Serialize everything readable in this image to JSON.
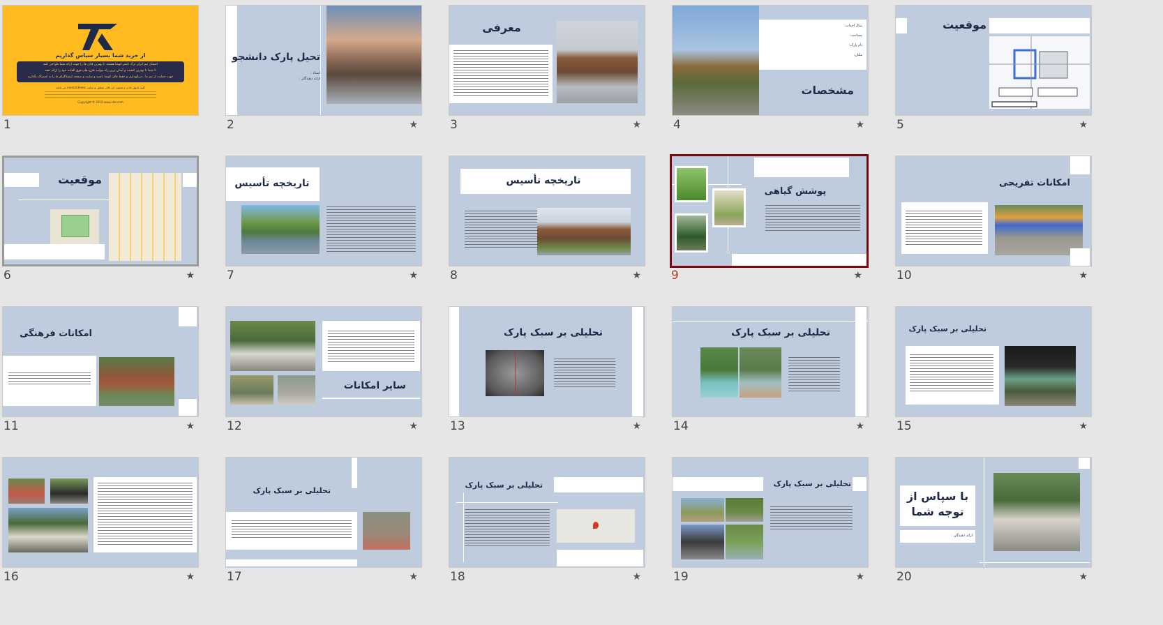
{
  "slides": [
    {
      "num": "1",
      "title": "از خرید شما بسیار سپاس گذاریم",
      "lines": [
        "اعضای تیم ایران ترک تایمز کوشا هستند تا بهترین فایل ها را جهت ارائه شما طراحی کنند",
        "تا شما با بهترین کیفیت و آسان ترین راه بتوانید طرح های فوق العاده خود را ارائه دهید",
        "جهت حمایت از تیم ما ، درنگهداری و حفظ فایل کوشا باشید و سایت و صفحه اینستاگرام ما را به اشتراک بگذارید"
      ],
      "note_1": "کلیه حقوق مادی و معنوی این فایل متعلق به سایت irantarktimes می باشد",
      "note_2": "Copyright © 2019 www.site.com"
    },
    {
      "num": "2",
      "title": "تحیل پارک دانشجو",
      "sub_1": "استاد :",
      "sub_2": "ارائه دهندگان :"
    },
    {
      "num": "3",
      "title": "معرفی"
    },
    {
      "num": "4",
      "title": "مشخصات",
      "info_1": "سال احداث:",
      "info_2": "مساحت:",
      "info_3": "نام پارک:",
      "info_4": "مکان:"
    },
    {
      "num": "5",
      "title": "موقعیت"
    },
    {
      "num": "6",
      "title": "موقعیت"
    },
    {
      "num": "7",
      "title": "تاریخچه تأسیس"
    },
    {
      "num": "8",
      "title": "تاریخچه تأسیس"
    },
    {
      "num": "9",
      "title": "پوشش گیاهی"
    },
    {
      "num": "10",
      "title": "امکانات تفریحی"
    },
    {
      "num": "11",
      "title": "امکانات فرهنگی"
    },
    {
      "num": "12",
      "title": "سایر امکانات"
    },
    {
      "num": "13",
      "title": "تحلیلی بر سبک پارک"
    },
    {
      "num": "14",
      "title": "تحلیلی بر سبک پارک"
    },
    {
      "num": "15",
      "title": "تحلیلی بر سبک پارک"
    },
    {
      "num": "16",
      "title": ""
    },
    {
      "num": "17",
      "title": "تحلیلی بر سبک پارک"
    },
    {
      "num": "18",
      "title": "تحلیلی بر سبک پارک"
    },
    {
      "num": "19",
      "title": "تحلیلی بر سبک پارک"
    },
    {
      "num": "20",
      "title_1": "با سپاس از",
      "title_2": "توجه شما",
      "sub": "ارائه دهندگان :"
    }
  ],
  "selected_slide": "9",
  "icons": {
    "star": "★"
  },
  "colors": {
    "slide_bg": "#bfccdd",
    "title": "#1e2a48",
    "selection": "#7a0a12",
    "yellow": "#ffbb1f"
  }
}
